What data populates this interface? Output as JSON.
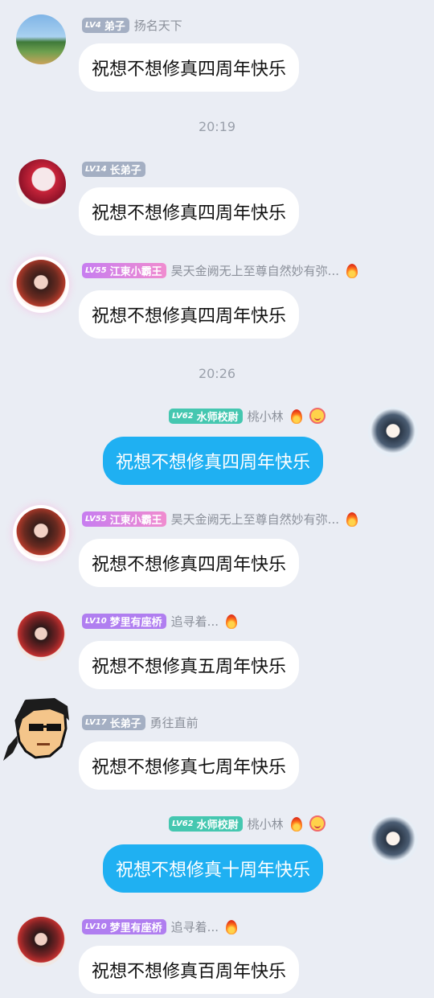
{
  "timestamps": [
    "20:19",
    "20:26"
  ],
  "messages": [
    {
      "side": "left",
      "avatar_icon": "landscape-avatar-icon",
      "badge_lv": "LV4",
      "badge_title": "弟子",
      "badge_color": "#a4afc3",
      "nickname": "扬名天下",
      "text": "祝想不想修真四周年快乐"
    },
    {
      "side": "left",
      "avatar_icon": "red-hair-girl-avatar-icon",
      "badge_lv": "LV14",
      "badge_title": "长弟子",
      "badge_color": "#a4afc3",
      "nickname": "",
      "text": "祝想不想修真四周年快乐"
    },
    {
      "side": "left",
      "avatar_icon": "dark-hair-girl-avatar-icon",
      "badge_lv": "LV55",
      "badge_title": "江東小霸王",
      "badge_color": "#d384e3",
      "nickname": "昊天金阙无上至尊自然妙有弥...",
      "text": "祝想不想修真四周年快乐",
      "emoji": "fire-icon"
    },
    {
      "side": "right",
      "avatar_icon": "blue-hair-man-avatar-icon",
      "badge_lv": "LV62",
      "badge_title": "水师校尉",
      "badge_color": "#45c7b0",
      "nickname": "桃小林",
      "text": "祝想不想修真四周年快乐",
      "emoji": "fire-icon",
      "emoji2": "smile-icon"
    },
    {
      "side": "left",
      "avatar_icon": "dark-hair-girl-avatar-icon",
      "badge_lv": "LV55",
      "badge_title": "江東小霸王",
      "badge_color": "#d384e3",
      "nickname": "昊天金阙无上至尊自然妙有弥...",
      "text": "祝想不想修真四周年快乐",
      "emoji": "fire-icon"
    },
    {
      "side": "left",
      "avatar_icon": "red-girl-avatar-icon",
      "badge_lv": "LV10",
      "badge_title": "梦里有座桥",
      "badge_color": "#b07ef0",
      "nickname": "追寻着...",
      "text": "祝想不想修真五周年快乐",
      "emoji": "campfire-icon"
    },
    {
      "side": "left",
      "avatar_icon": "pixel-sunglasses-avatar-icon",
      "badge_lv": "LV17",
      "badge_title": "长弟子",
      "badge_color": "#a4afc3",
      "nickname": "勇往直前",
      "text": "祝想不想修真七周年快乐"
    },
    {
      "side": "right",
      "avatar_icon": "blue-hair-man-avatar-icon",
      "badge_lv": "LV62",
      "badge_title": "水师校尉",
      "badge_color": "#45c7b0",
      "nickname": "桃小林",
      "text": "祝想不想修真十周年快乐",
      "emoji": "fire-icon",
      "emoji2": "smile-icon"
    },
    {
      "side": "left",
      "avatar_icon": "red-girl-avatar-icon",
      "badge_lv": "LV10",
      "badge_title": "梦里有座桥",
      "badge_color": "#b07ef0",
      "nickname": "追寻着...",
      "text": "祝想不想修真百周年快乐",
      "emoji": "campfire-icon"
    }
  ]
}
